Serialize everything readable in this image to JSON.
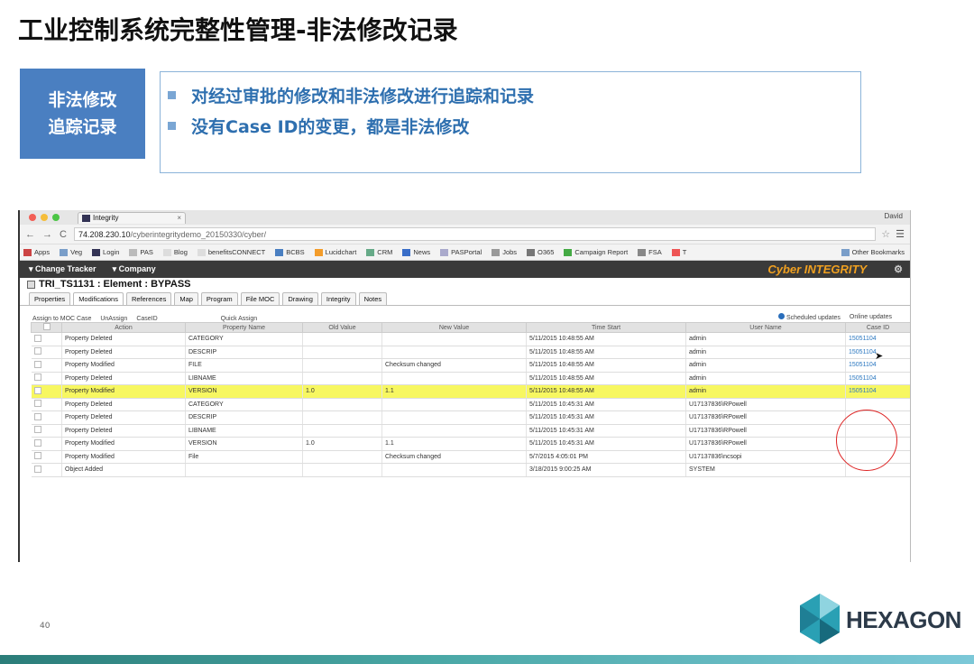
{
  "slide": {
    "title": "工业控制系统完整性管理-非法修改记录",
    "tag_line1": "非法修改",
    "tag_line2": "追踪记录",
    "bullets": [
      "对经过审批的修改和非法修改进行追踪和记录",
      "没有Case ID的变更，都是非法修改"
    ],
    "page_number": "40",
    "logo_text": "HEXAGON"
  },
  "browser": {
    "tab_title": "Integrity",
    "tab_close": "×",
    "user": "David",
    "url_host": "74.208.230.10",
    "url_path": "/cyberintegritydemo_20150330/cyber/",
    "bookmarks": [
      "Apps",
      "Veg",
      "Login",
      "PAS",
      "Blog",
      "benefitsCONNECT",
      "BCBS",
      "Lucidchart",
      "CRM",
      "News",
      "PASPortal",
      "Jobs",
      "O365",
      "Campaign Report",
      "FSA",
      "T"
    ],
    "other_bookmarks": "Other Bookmarks"
  },
  "app": {
    "menu_change_tracker": "Change Tracker",
    "menu_company": "Company",
    "logo": "Cyber INTEGRITY",
    "record_title": "TRI_TS1131 : Element : BYPASS",
    "tabs": [
      "Properties",
      "Modifications",
      "References",
      "Map",
      "Program",
      "File MOC",
      "Drawing",
      "Integrity",
      "Notes"
    ],
    "toolbar": {
      "assign": "Assign to MOC Case",
      "unassign": "UnAssign",
      "caseid": "CaseID",
      "quick_assign": "Quick Assign",
      "scheduled": "Scheduled updates",
      "online": "Online updates"
    },
    "columns": [
      "Action",
      "Property Name",
      "Old Value",
      "New Value",
      "Time Start",
      "User Name",
      "Case ID"
    ],
    "rows": [
      {
        "action": "Property Deleted",
        "property": "CATEGORY",
        "old": "",
        "new": "",
        "time": "5/11/2015 10:48:55 AM",
        "user": "admin",
        "case": "15051104"
      },
      {
        "action": "Property Deleted",
        "property": "DESCRIP",
        "old": "",
        "new": "",
        "time": "5/11/2015 10:48:55 AM",
        "user": "admin",
        "case": "15051104"
      },
      {
        "action": "Property Modified",
        "property": "FILE",
        "old": "",
        "new": "Checksum changed",
        "time": "5/11/2015 10:48:55 AM",
        "user": "admin",
        "case": "15051104"
      },
      {
        "action": "Property Deleted",
        "property": "LIBNAME",
        "old": "",
        "new": "",
        "time": "5/11/2015 10:48:55 AM",
        "user": "admin",
        "case": "15051104"
      },
      {
        "action": "Property Modified",
        "property": "VERSION",
        "old": "1.0",
        "new": "1.1",
        "time": "5/11/2015 10:48:55 AM",
        "user": "admin",
        "case": "15051104"
      },
      {
        "action": "Property Deleted",
        "property": "CATEGORY",
        "old": "",
        "new": "",
        "time": "5/11/2015 10:45:31 AM",
        "user": "U17137836\\RPowell",
        "case": ""
      },
      {
        "action": "Property Deleted",
        "property": "DESCRIP",
        "old": "",
        "new": "",
        "time": "5/11/2015 10:45:31 AM",
        "user": "U17137836\\RPowell",
        "case": ""
      },
      {
        "action": "Property Deleted",
        "property": "LIBNAME",
        "old": "",
        "new": "",
        "time": "5/11/2015 10:45:31 AM",
        "user": "U17137836\\RPowell",
        "case": ""
      },
      {
        "action": "Property Modified",
        "property": "VERSION",
        "old": "1.0",
        "new": "1.1",
        "time": "5/11/2015 10:45:31 AM",
        "user": "U17137836\\RPowell",
        "case": ""
      },
      {
        "action": "Property Modified",
        "property": "File",
        "old": "",
        "new": "Checksum changed",
        "time": "5/7/2015 4:05:01 PM",
        "user": "U17137836\\ncsopi",
        "case": ""
      },
      {
        "action": "Object Added",
        "property": "",
        "old": "",
        "new": "",
        "time": "3/18/2015 9:00:25 AM",
        "user": "SYSTEM",
        "case": ""
      }
    ],
    "highlight_row": 4
  },
  "colors": {
    "title_accent": "#4a7fc1",
    "bullet_text": "#2e6faf",
    "highlight": "#f7f761",
    "annotation_circle": "#dd2222",
    "cyber_orange": "#f0a020"
  },
  "icons": [
    "back-icon",
    "forward-icon",
    "reload-icon",
    "star-icon",
    "menu-icon",
    "gear-icon",
    "cursor-icon",
    "hexagon-logo-icon"
  ]
}
